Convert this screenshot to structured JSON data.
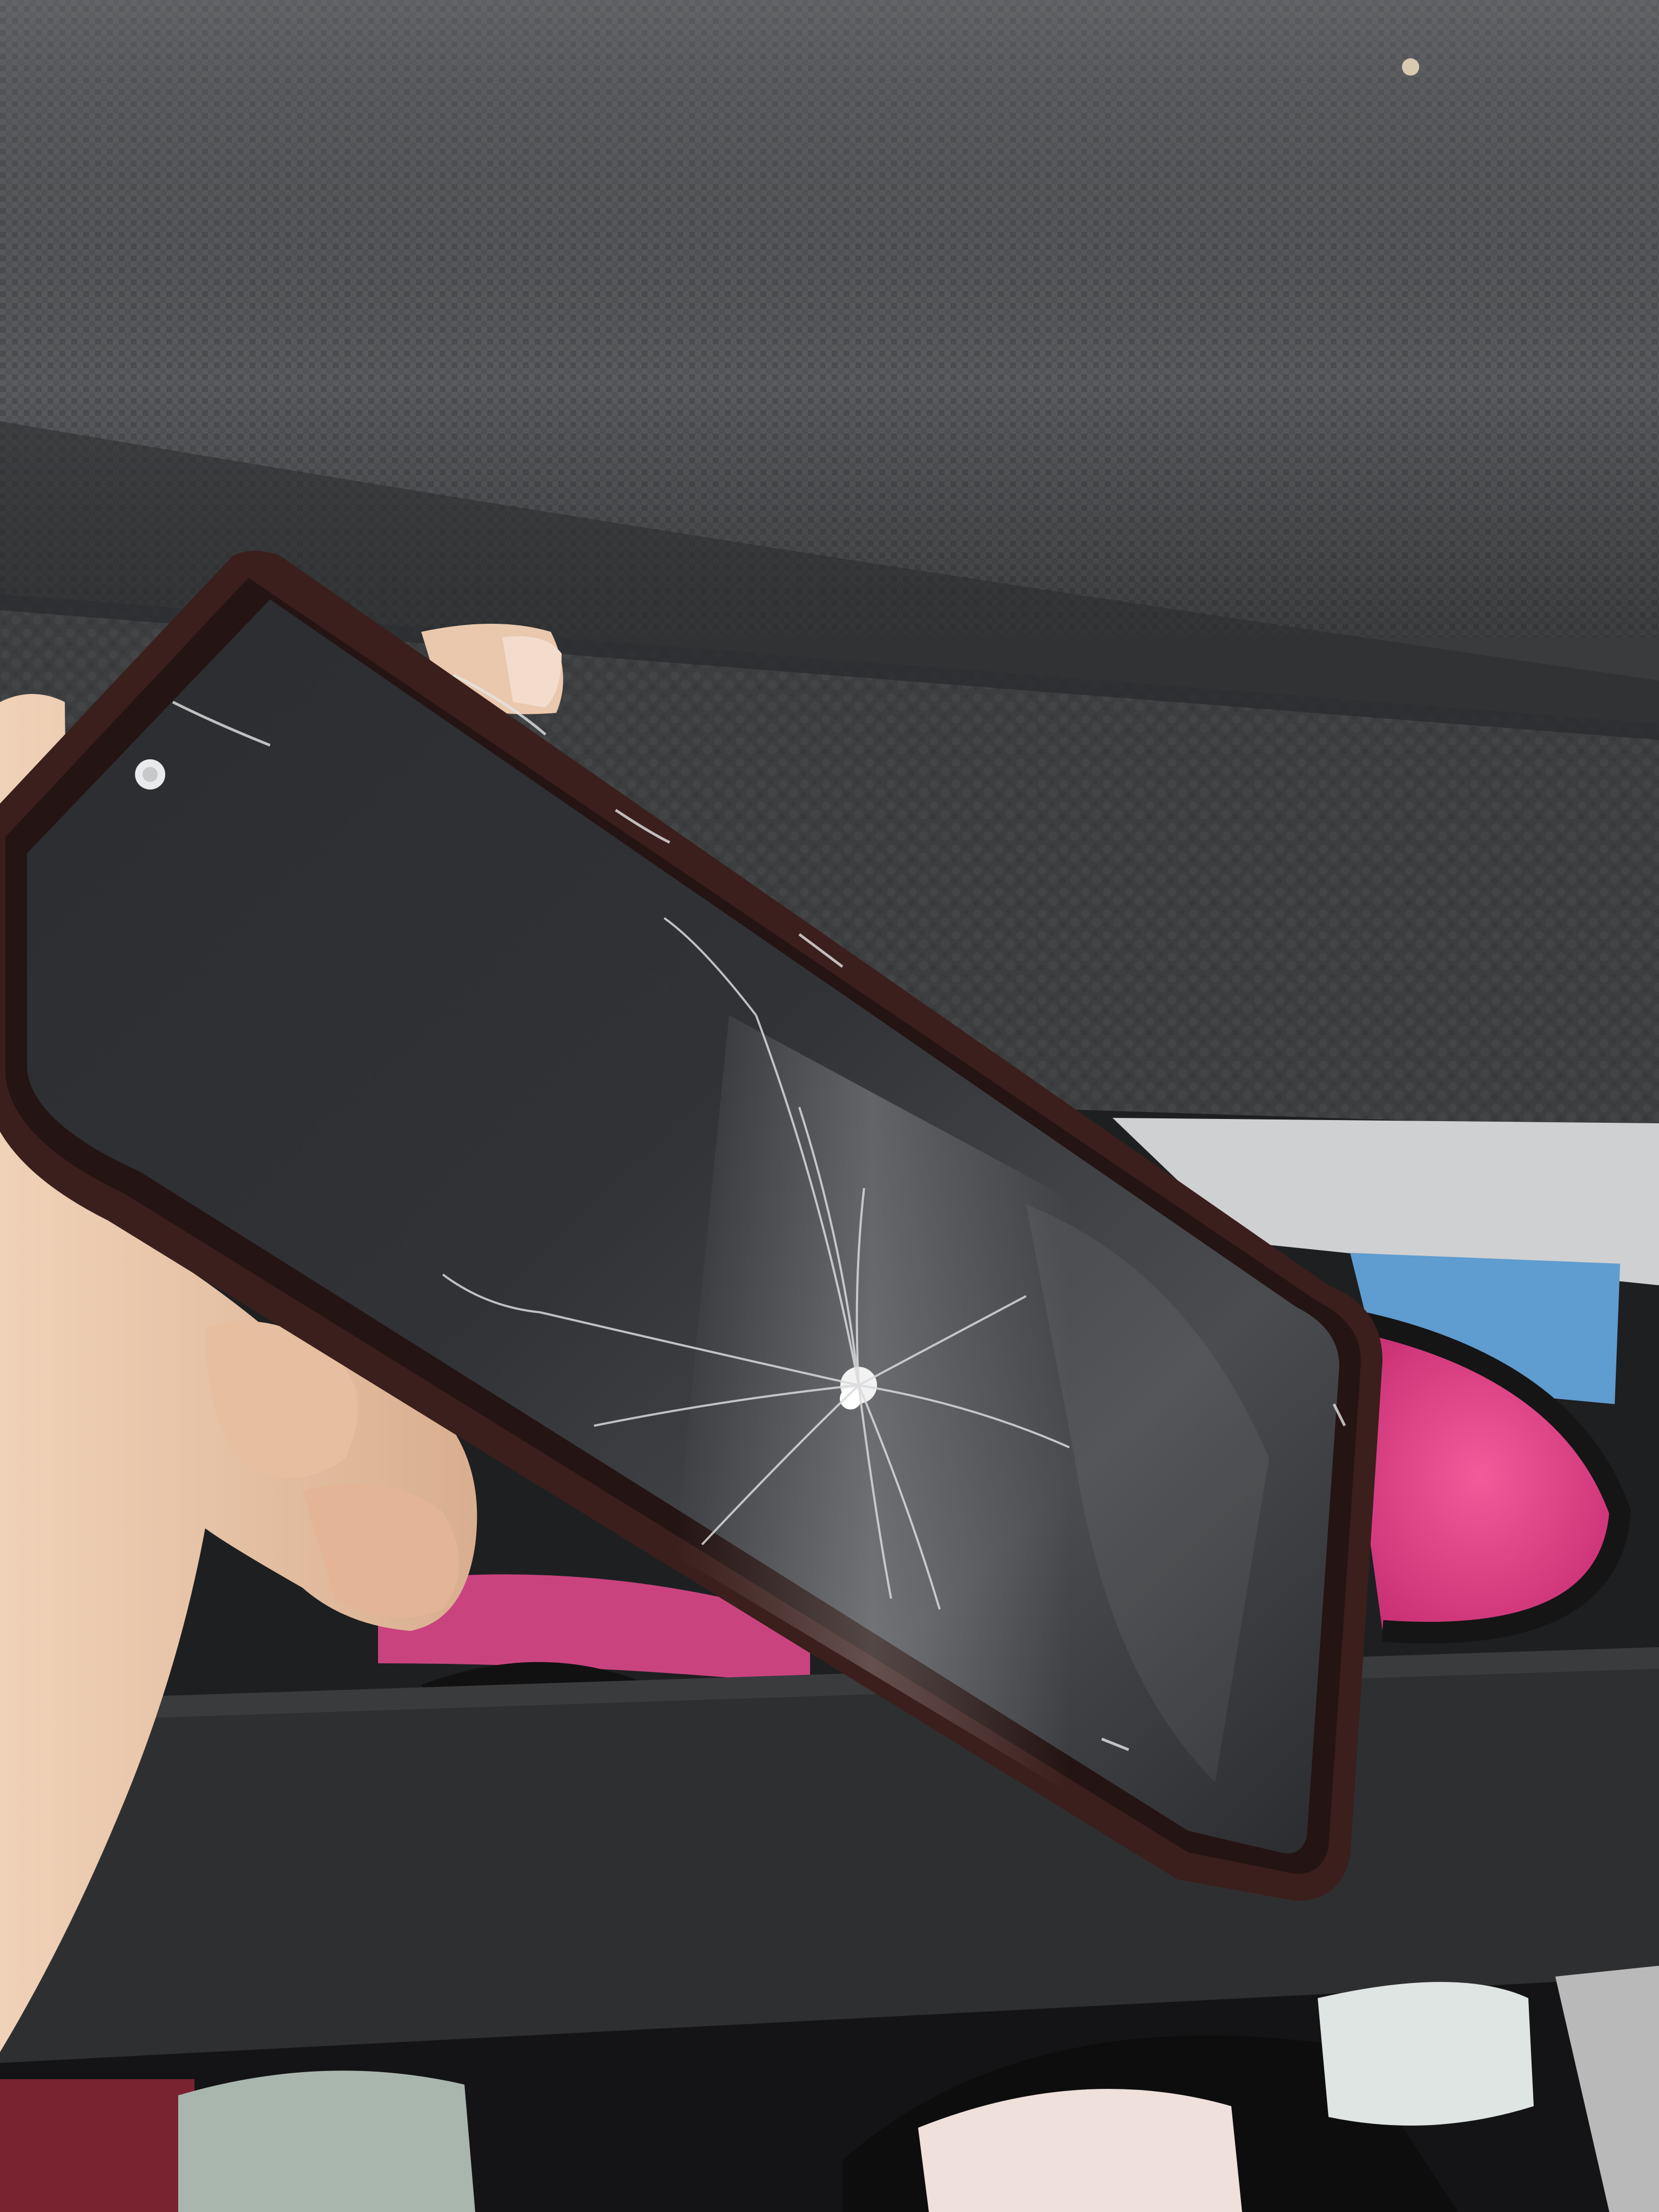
{
  "scene": {
    "subject": "phone-with-cracked-screen",
    "colors": {
      "dashboard_top": "#5a5c5f",
      "dashboard_grain": "#4a4c4f",
      "dashboard_lower": "#3c3d3f",
      "shelf": "#2f3032",
      "cubby_shadow": "#1c1c1e",
      "phone_case": "#3a1f1c",
      "phone_screen": "#2a2c2e",
      "screen_reflection": "#6a6c6e",
      "skin": "#e7c4a8",
      "pink_item": "#ea3f8a",
      "blue_item": "#5f9ccf",
      "white_item": "#e8e8e8",
      "floor_red": "#7a2330"
    }
  }
}
